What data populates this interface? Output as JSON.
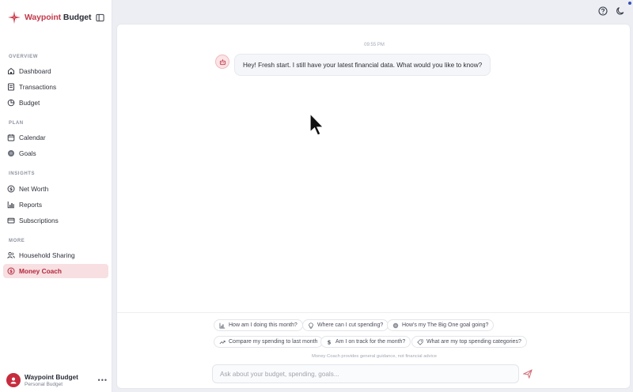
{
  "brand": {
    "name_prefix": "Waypoint",
    "name_suffix": " Budget"
  },
  "sections": {
    "overview": "OVERVIEW",
    "plan": "PLAN",
    "insights": "INSIGHTS",
    "more": "MORE"
  },
  "nav": {
    "dashboard": "Dashboard",
    "transactions": "Transactions",
    "budget": "Budget",
    "calendar": "Calendar",
    "goals": "Goals",
    "net_worth": "Net Worth",
    "reports": "Reports",
    "subscriptions": "Subscriptions",
    "household_sharing": "Household Sharing",
    "money_coach": "Money Coach"
  },
  "user": {
    "name": "Waypoint Budget",
    "subtitle": "Personal Budget",
    "more": "•••"
  },
  "chat": {
    "timestamp": "09:55 PM",
    "message": "Hey! Fresh start. I still have your latest financial data. What would you like to know?"
  },
  "suggestions": {
    "s1": "How am I doing this month?",
    "s2": "Where can I cut spending?",
    "s3": "How's my The Big One goal going?",
    "s4": "Compare my spending to last month",
    "s5": "Am I on track for the month?",
    "s6": "What are my top spending categories?"
  },
  "disclaimer": "Money Coach provides general guidance, not financial advice",
  "composer": {
    "placeholder": "Ask about your budget, spending, goals..."
  },
  "colors": {
    "brand": "#c33a4a",
    "active_bg": "#f7dfe2",
    "active_text": "#b4283c"
  }
}
